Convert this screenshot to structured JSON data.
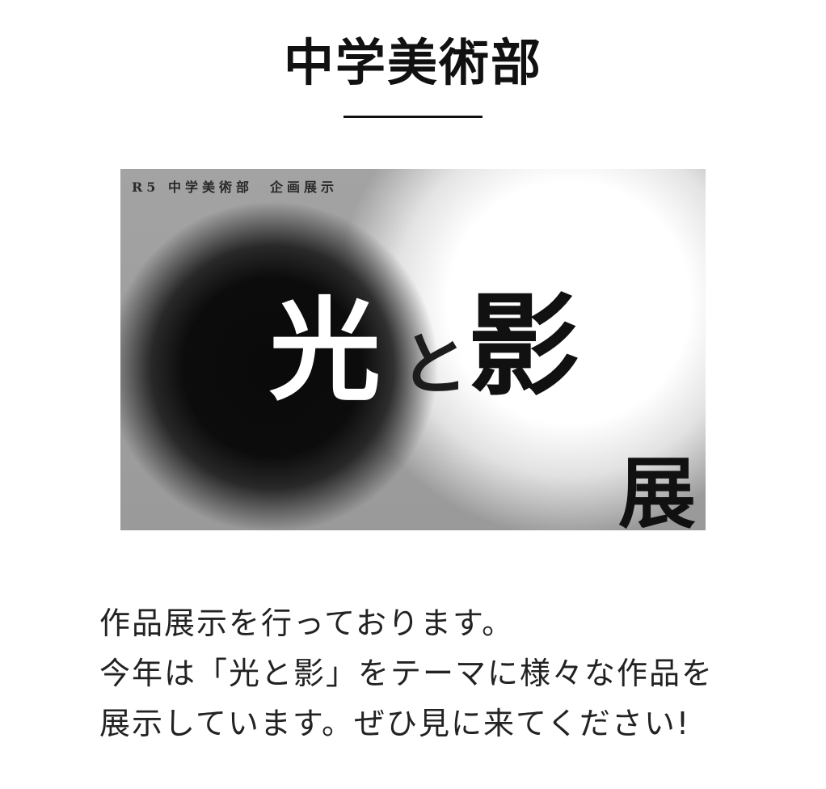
{
  "page": {
    "title": "中学美術部"
  },
  "poster": {
    "header": "R5 中学美術部　企画展示",
    "word_light": "光",
    "word_to": "と",
    "word_shadow": "影",
    "word_exhibit": "展"
  },
  "description": {
    "lines": [
      "作品展示を行っております。",
      "今年は「光と影」をテーマに様々な作品を",
      "展示しています。ぜひ見に来てください!"
    ]
  },
  "colors": {
    "text": "#1a1a1a",
    "background": "#ffffff",
    "accent_line": "#111111"
  }
}
